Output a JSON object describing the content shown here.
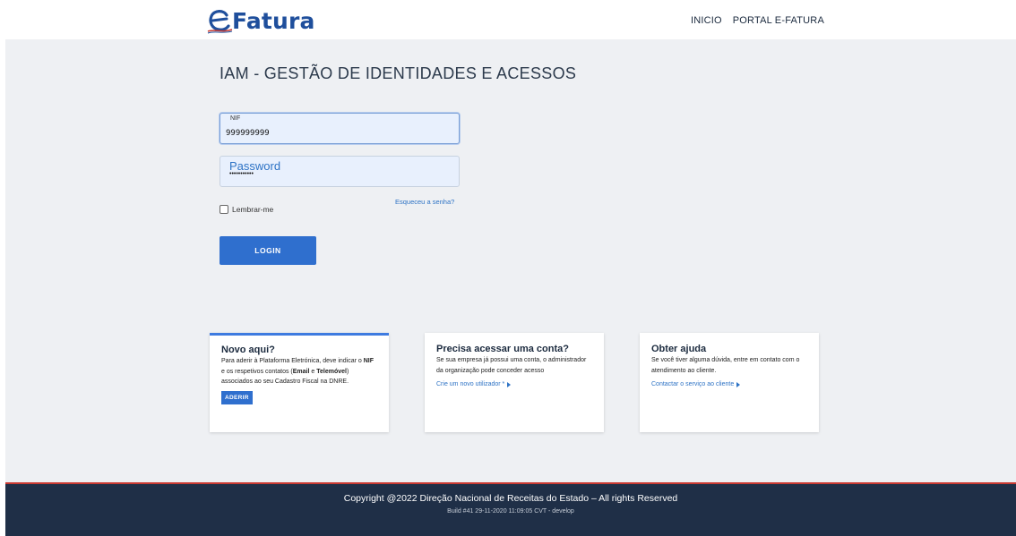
{
  "header": {
    "logo_text": "Fatura",
    "nav": [
      "INICIO",
      "PORTAL E-FATURA"
    ]
  },
  "login": {
    "title": "IAM - GESTÃO DE IDENTIDADES E ACESSOS",
    "nif_label": "NIF",
    "nif_value": "999999999",
    "password_label": "Password",
    "password_value": "•••••••••••",
    "remember_label": "Lembrar-me",
    "remember_checked": false,
    "forgot_label": "Esqueceu a senha?",
    "login_button": "LOGIN"
  },
  "cards": [
    {
      "title": "Novo aqui?",
      "text_parts": [
        "Para aderir à Plataforma Eletrónica, deve indicar o ",
        "NIF",
        " e os respetivos contatos (",
        "Email",
        " e ",
        "Telemóvel",
        ") associados ao seu Cadastro Fiscal na DNRE."
      ],
      "button": "ADERIR"
    },
    {
      "title": "Precisa acessar uma conta?",
      "text": "Se sua empresa já possui uma conta, o administrador da organização pode conceder acesso",
      "link": "Crie um novo utilizador *"
    },
    {
      "title": "Obter ajuda",
      "text": "Se você tiver alguma dúvida, entre em contato com o atendimento ao cliente.",
      "link": "Contactar o serviço ao cliente"
    }
  ],
  "footer": {
    "copyright": "Copyright @2022 Direção Nacional de Receitas do Estado – All rights Reserved",
    "build": "Build #41 29-11-2020 11:09:05 CVT - develop"
  },
  "colors": {
    "brand_blue": "#1f4f9c",
    "accent_blue": "#2f6fce",
    "footer_bg": "#1f2f47",
    "footer_accent": "#c83a32"
  }
}
